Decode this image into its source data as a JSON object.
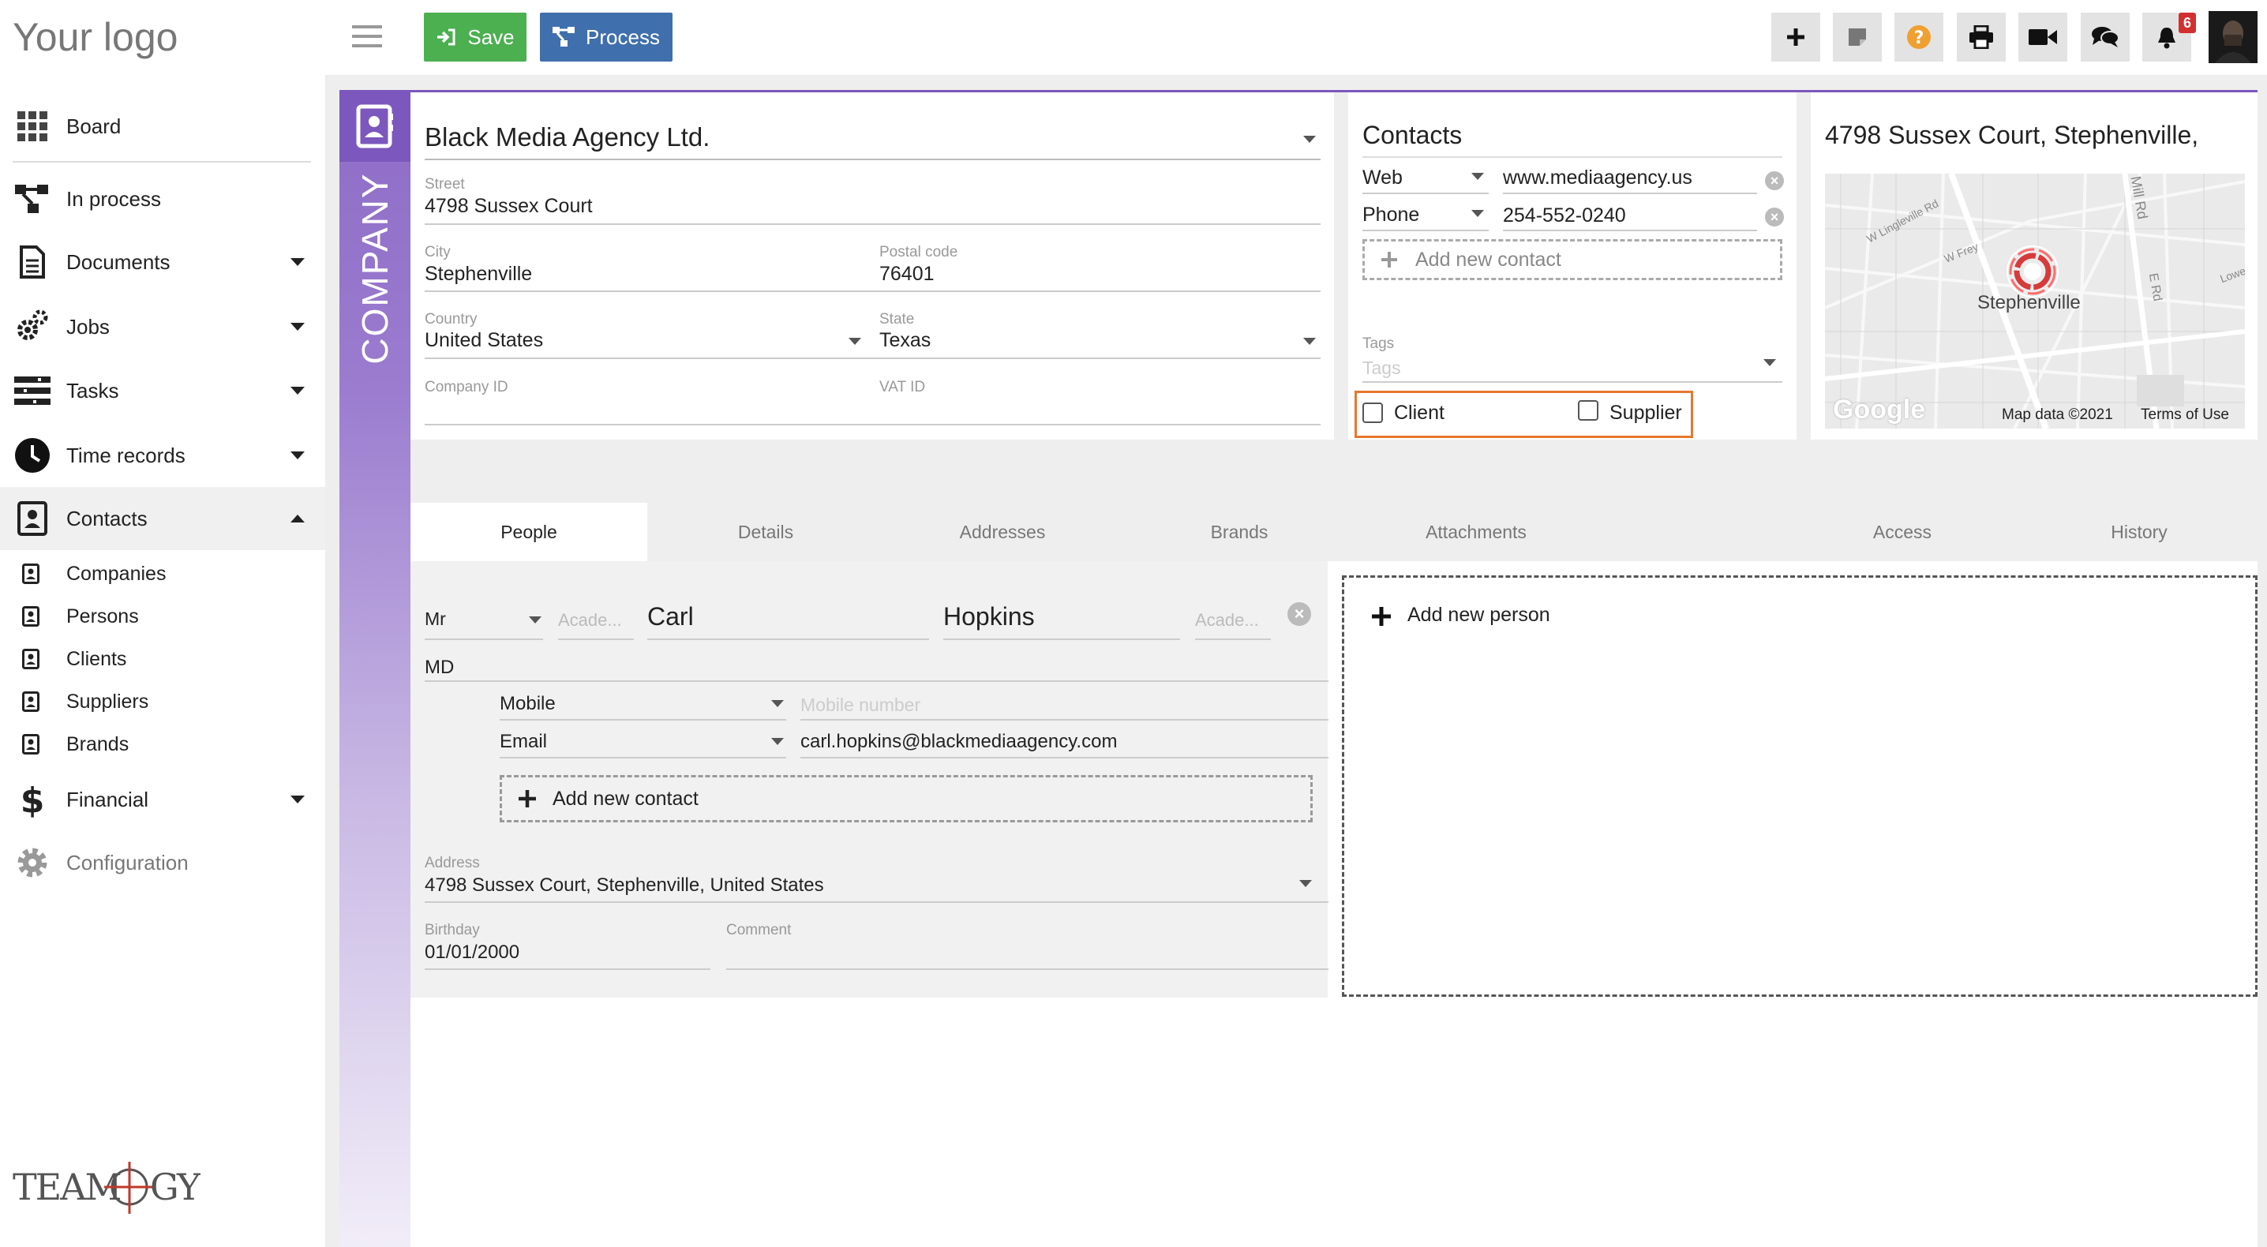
{
  "sidebar": {
    "logo": "Your logo",
    "items": [
      {
        "label": "Board"
      },
      {
        "label": "In process"
      },
      {
        "label": "Documents"
      },
      {
        "label": "Jobs"
      },
      {
        "label": "Tasks"
      },
      {
        "label": "Time records"
      },
      {
        "label": "Contacts"
      },
      {
        "label": "Financial"
      },
      {
        "label": "Configuration"
      }
    ],
    "sub_items": [
      {
        "label": "Companies"
      },
      {
        "label": "Persons"
      },
      {
        "label": "Clients"
      },
      {
        "label": "Suppliers"
      },
      {
        "label": "Brands"
      }
    ],
    "footer_logo": "TEAMOGY"
  },
  "toolbar": {
    "save_label": "Save",
    "process_label": "Process",
    "notification_count": "6",
    "icons": [
      "plus-icon",
      "note-icon",
      "help-icon",
      "print-icon",
      "video-icon",
      "chat-icon",
      "bell-icon"
    ]
  },
  "company": {
    "section_label": "COMPANY",
    "name": "Black Media Agency Ltd.",
    "street_label": "Street",
    "street": "4798  Sussex Court",
    "city_label": "City",
    "city": "Stephenville",
    "postal_label": "Postal code",
    "postal": "76401",
    "country_label": "Country",
    "country": "United States",
    "state_label": "State",
    "state": "Texas",
    "company_id_label": "Company ID",
    "vat_label": "VAT ID"
  },
  "contacts": {
    "title": "Contacts",
    "rows": [
      {
        "type": "Web",
        "value": "www.mediaagency.us"
      },
      {
        "type": "Phone",
        "value": "254-552-0240"
      }
    ],
    "add_label": "Add new contact",
    "tags_label": "Tags",
    "tags_placeholder": "Tags",
    "client_label": "Client",
    "supplier_label": "Supplier"
  },
  "map": {
    "title": "4798 Sussex Court, Stephenville,",
    "city": "Stephenville",
    "streets": [
      "W Lingleville Rd",
      "W Frey",
      "Mill Rd",
      "E Rd",
      "Lowe"
    ],
    "attribution": "Map data ©2021",
    "terms": "Terms of Use",
    "google": "Google"
  },
  "tabs": [
    {
      "label": "People"
    },
    {
      "label": "Details"
    },
    {
      "label": "Addresses"
    },
    {
      "label": "Brands"
    },
    {
      "label": "Attachments"
    },
    {
      "label": "Access"
    },
    {
      "label": "History"
    }
  ],
  "person": {
    "salutation": "Mr",
    "academic_placeholder": "Acade...",
    "first_name": "Carl",
    "last_name": "Hopkins",
    "academic_after_placeholder": "Acade...",
    "degree": "MD",
    "contacts": [
      {
        "type": "Mobile",
        "value": "",
        "placeholder": "Mobile number"
      },
      {
        "type": "Email",
        "value": "carl.hopkins@blackmediaagency.com",
        "placeholder": ""
      }
    ],
    "add_contact_label": "Add new contact",
    "address_label": "Address",
    "address": "4798 Sussex Court, Stephenville, United States",
    "birthday_label": "Birthday",
    "birthday": "01/01/2000",
    "comment_label": "Comment"
  },
  "add_person_label": "Add new person",
  "colors": {
    "accent_purple": "#7c57bd",
    "save_green": "#4caf50",
    "process_blue": "#3f6fad",
    "highlight_orange": "#e8772e",
    "help_orange": "#f0a030",
    "badge_red": "#d32f2f"
  }
}
